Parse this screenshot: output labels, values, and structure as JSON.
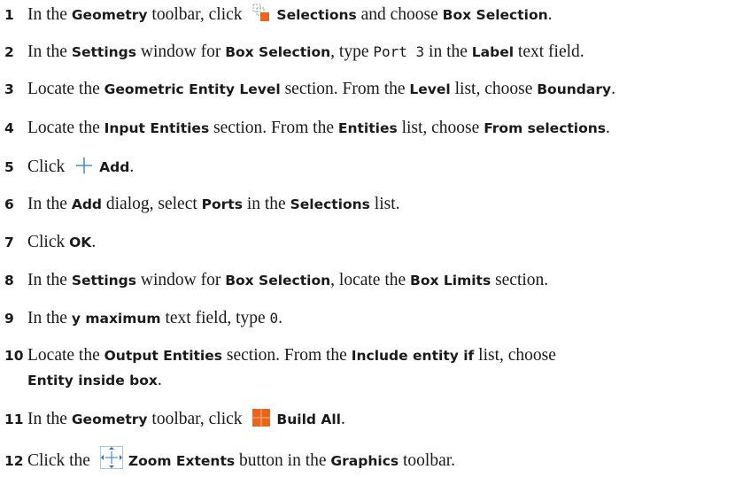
{
  "steps": [
    {
      "n": "1",
      "t1": "In the ",
      "b1": "Geometry",
      "t2": " toolbar, click ",
      "icon": "selections-icon",
      "b2": "Selections",
      "t3": " and choose ",
      "b3": "Box Selection",
      "t4": "."
    },
    {
      "n": "2",
      "t1": "In the ",
      "b1": "Settings",
      "t2": " window for ",
      "b2": "Box Selection",
      "t3": ", type ",
      "code": "Port 3",
      "t4": " in the ",
      "b3": "Label",
      "t5": " text field."
    },
    {
      "n": "3",
      "t1": "Locate the ",
      "b1": "Geometric Entity Level",
      "t2": " section. From the ",
      "b2": "Level",
      "t3": " list, choose ",
      "b3": "Boundary",
      "t4": "."
    },
    {
      "n": "4",
      "t1": "Locate the ",
      "b1": "Input Entities",
      "t2": " section. From the ",
      "b2": "Entities",
      "t3": " list, choose ",
      "b3": "From selections",
      "t4": "."
    },
    {
      "n": "5",
      "t1": "Click ",
      "icon": "add-icon",
      "b1": "Add",
      "t2": "."
    },
    {
      "n": "6",
      "t1": "In the ",
      "b1": "Add",
      "t2": " dialog, select ",
      "b2": "Ports",
      "t3": " in the ",
      "b3": "Selections",
      "t4": " list."
    },
    {
      "n": "7",
      "t1": "Click ",
      "b1": "OK",
      "t2": "."
    },
    {
      "n": "8",
      "t1": "In the ",
      "b1": "Settings",
      "t2": " window for ",
      "b2": "Box Selection",
      "t3": ", locate the ",
      "b3": "Box Limits",
      "t4": " section."
    },
    {
      "n": "9",
      "t1": "In the ",
      "b1": "y maximum",
      "t2": " text field, type ",
      "code": "0",
      "t3": "."
    },
    {
      "n": "10",
      "t1": "Locate the ",
      "b1": "Output Entities",
      "t2": " section. From the ",
      "b2": "Include entity if",
      "t3": " list, choose",
      "b3": "Entity inside box",
      "t4": "."
    },
    {
      "n": "11",
      "t1": "In the ",
      "b1": "Geometry",
      "t2": " toolbar, click ",
      "icon": "build-all-icon",
      "b2": "Build All",
      "t3": "."
    },
    {
      "n": "12",
      "t1": "Click the ",
      "icon": "zoom-extents-icon",
      "b1": "Zoom Extents",
      "t2": " button in the ",
      "b2": "Graphics",
      "t3": " toolbar."
    }
  ]
}
